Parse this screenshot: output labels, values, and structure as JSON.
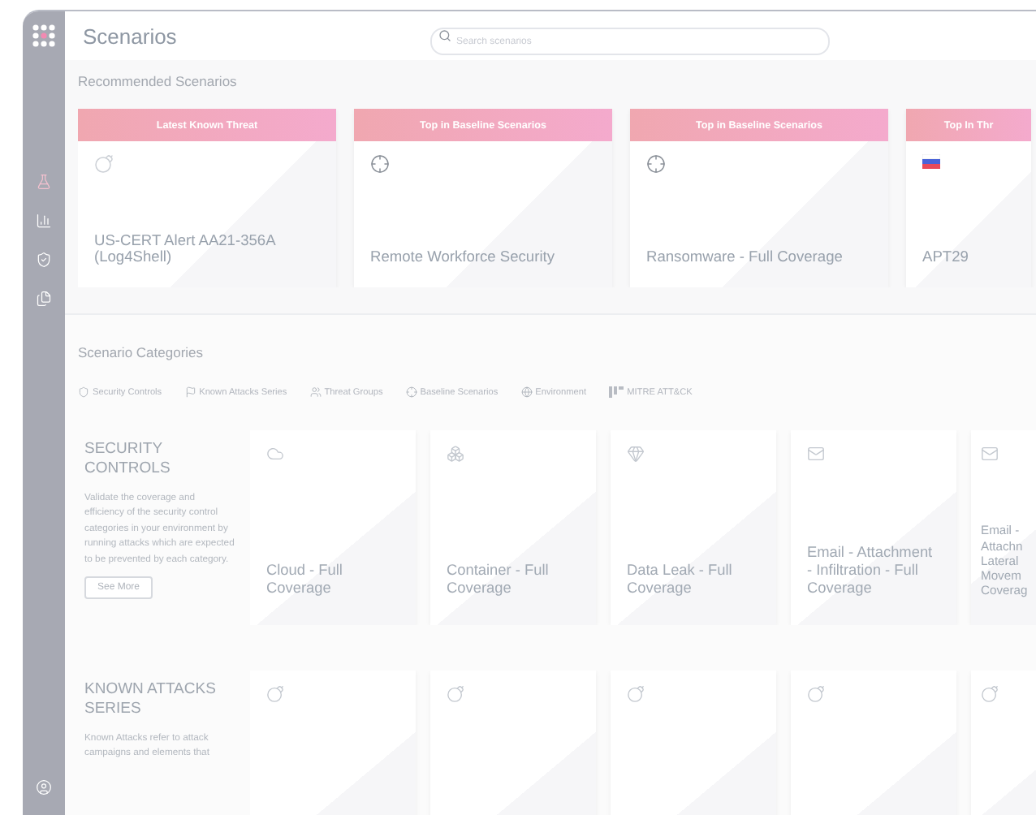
{
  "header": {
    "title": "Scenarios",
    "search": {
      "placeholder": "Search scenarios"
    }
  },
  "sidebar": {
    "items": [
      {
        "kind": "flask"
      },
      {
        "kind": "chart"
      },
      {
        "kind": "shield"
      },
      {
        "kind": "files"
      }
    ],
    "footer": {
      "kind": "user"
    }
  },
  "recommended": {
    "title": "Recommended Scenarios",
    "cards": [
      {
        "banner": "Latest Known Threat",
        "kind": "bomb",
        "title": "US-CERT Alert AA21-356A (Log4Shell)"
      },
      {
        "banner": "Top in Baseline Scenarios",
        "kind": "crosshair",
        "title": "Remote Workforce Security"
      },
      {
        "banner": "Top in Baseline Scenarios",
        "kind": "crosshair",
        "title": "Ransomware - Full Coverage"
      },
      {
        "banner": "Top In Thr",
        "kind": "russia",
        "title": "APT29"
      }
    ]
  },
  "categories": {
    "title": "Scenario Categories",
    "tabs": [
      {
        "label": "Security Controls",
        "kind": "shield"
      },
      {
        "label": "Known Attacks Series",
        "kind": "flag"
      },
      {
        "label": "Threat Groups",
        "kind": "users"
      },
      {
        "label": "Baseline Scenarios",
        "kind": "crosshair"
      },
      {
        "label": "Environment",
        "kind": "globe"
      },
      {
        "label": "MITRE ATT&CK",
        "kind": "mitre"
      }
    ]
  },
  "sections": [
    {
      "title": "SECURITY CONTROLS",
      "description": "Validate the coverage and efficiency of the security control categories in your environment by running attacks which are expected to be prevented by each category.",
      "button": "See More",
      "cards": [
        {
          "kind": "cloud",
          "title": "Cloud - Full Coverage"
        },
        {
          "kind": "boxes",
          "title": "Container - Full Coverage"
        },
        {
          "kind": "gem",
          "title": "Data Leak - Full Coverage"
        },
        {
          "kind": "mail",
          "title": "Email - Attachment - Infiltration - Full Coverage"
        },
        {
          "kind": "mail",
          "title": "Email - Attachn Lateral Movem Coverag"
        }
      ]
    },
    {
      "title": "KNOWN ATTACKS SERIES",
      "description": "Known Attacks refer to attack campaigns and elements that",
      "cards": [
        {
          "kind": "bomb"
        },
        {
          "kind": "bomb"
        },
        {
          "kind": "bomb"
        },
        {
          "kind": "bomb"
        },
        {
          "kind": "bomb"
        }
      ]
    }
  ]
}
